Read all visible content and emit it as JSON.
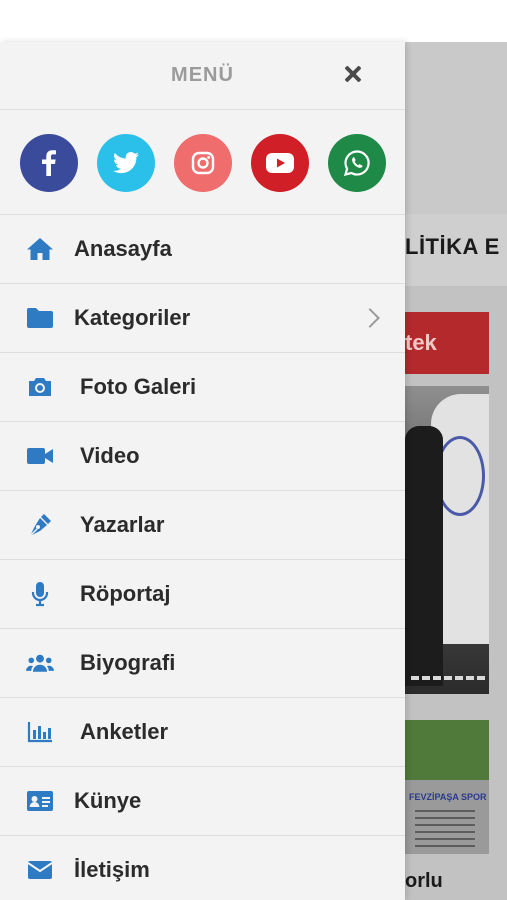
{
  "drawer": {
    "title": "MENÜ",
    "close_icon": "close-icon"
  },
  "social": [
    {
      "name": "facebook",
      "icon": "facebook-icon",
      "color": "#3b4b9b"
    },
    {
      "name": "twitter",
      "icon": "twitter-icon",
      "color": "#2bc0ea"
    },
    {
      "name": "instagram",
      "icon": "instagram-icon",
      "color": "#ef6d6d"
    },
    {
      "name": "youtube",
      "icon": "youtube-icon",
      "color": "#d01f26"
    },
    {
      "name": "whatsapp",
      "icon": "whatsapp-icon",
      "color": "#1f8a47"
    }
  ],
  "menu": {
    "items": [
      {
        "label": "Anasayfa",
        "icon": "home-icon"
      },
      {
        "label": "Kategoriler",
        "icon": "folder-icon",
        "has_submenu": true
      },
      {
        "label": "Foto Galeri",
        "icon": "camera-icon"
      },
      {
        "label": "Video",
        "icon": "video-camera-icon"
      },
      {
        "label": "Yazarlar",
        "icon": "pen-icon"
      },
      {
        "label": "Röportaj",
        "icon": "microphone-icon"
      },
      {
        "label": "Biyografi",
        "icon": "users-icon"
      },
      {
        "label": "Anketler",
        "icon": "bar-chart-icon"
      },
      {
        "label": "Künye",
        "icon": "id-card-icon"
      },
      {
        "label": "İletişim",
        "icon": "envelope-icon"
      }
    ],
    "icon_color": "#2e7bc4"
  },
  "background_page": {
    "nav_text": "LİTİKA E",
    "red_button_text": "tek",
    "thumb_caption": "FEVZİPAŞA SPOR",
    "bottom_text": "orlu"
  }
}
